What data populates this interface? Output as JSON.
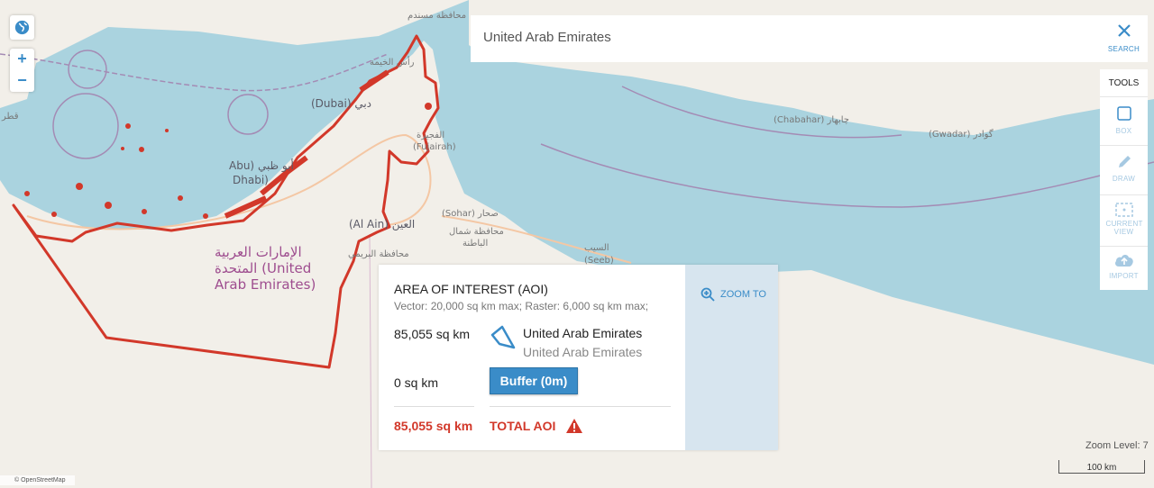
{
  "map": {
    "labels": [
      "محافظة مسندم",
      "رأس الخيمة",
      "(Dubai) دبي",
      "Abu) أبو ظبي",
      "Dhabi)",
      "الفجيرة",
      "(Fujairah)",
      "(Al Ain) العين",
      "محافظة البريمي",
      "(Sohar) صحار",
      "محافظة شمال",
      "الباطنة",
      "السيب",
      "(Seeb)",
      "(Chabahar) چابهار",
      "(Gwadar) گوادر",
      "قطر"
    ],
    "country_label": [
      "الإمارات العربية",
      "المتحدة (United",
      "Arab Emirates)"
    ],
    "colors": {
      "sea": "#aad3df",
      "land": "#f2efe9",
      "aoi": "#d2382a"
    }
  },
  "controls": {
    "zoom_in": "+",
    "zoom_out": "−",
    "globe_icon": "globe-icon"
  },
  "search": {
    "value": "United Arab Emirates"
  },
  "toolbar": {
    "search_label": "SEARCH",
    "tools_label": "TOOLS",
    "box_label": "BOX",
    "draw_label": "DRAW",
    "current_view_label": "CURRENT VIEW",
    "import_label": "IMPORT"
  },
  "aoi": {
    "title": "AREA OF INTEREST (AOI)",
    "subtitle": "Vector: 20,000 sq km max;  Raster: 6,000 sq km max;",
    "area": "85,055 sq km",
    "name": "United Arab Emirates",
    "name_sub": "United Arab Emirates",
    "buffer_area": "0 sq km",
    "buffer_label": "Buffer (0m)",
    "total_area": "85,055 sq km",
    "total_label": "TOTAL AOI",
    "zoom_to": "ZOOM TO"
  },
  "footer": {
    "zoom_level": "Zoom Level: 7",
    "scale": "100 km",
    "attribution": "© OpenStreetMap"
  }
}
